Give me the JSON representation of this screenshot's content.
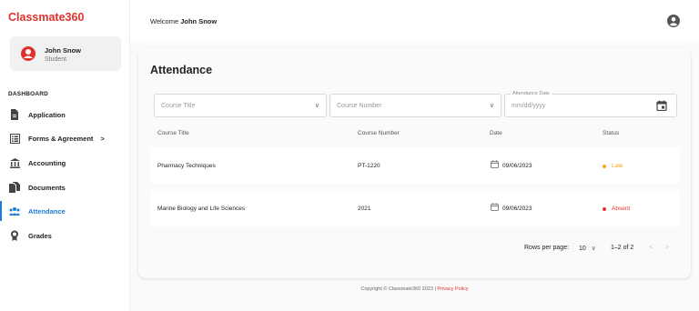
{
  "brand": "Classmate360",
  "user": {
    "name": "John Snow",
    "role": "Student"
  },
  "sidebar": {
    "section": "DASHBOARD",
    "items": [
      {
        "label": "Application",
        "icon": "document-icon"
      },
      {
        "label": "Forms & Agreement",
        "icon": "form-icon",
        "chevron": ">"
      },
      {
        "label": "Accounting",
        "icon": "bank-icon"
      },
      {
        "label": "Documents",
        "icon": "documents-icon"
      },
      {
        "label": "Attendance",
        "icon": "people-icon",
        "active": true
      },
      {
        "label": "Grades",
        "icon": "award-icon"
      }
    ]
  },
  "header": {
    "welcome_prefix": "Welcome",
    "welcome_name": "John Snow"
  },
  "page": {
    "title": "Attendance"
  },
  "filters": {
    "course_title_placeholder": "Course Title",
    "course_number_placeholder": "Course Number",
    "date_label": "Attendance Date",
    "date_placeholder": "mm/dd/yyyy"
  },
  "table": {
    "headers": [
      "Course Title",
      "Course Number",
      "Date",
      "Status"
    ],
    "rows": [
      {
        "course_title": "Pharmacy Techniques",
        "course_number": "PT-1220",
        "date": "09/06/2023",
        "status": "Late",
        "status_color": "#f5a623"
      },
      {
        "course_title": "Marine Biology and Life Sciences",
        "course_number": "2021",
        "date": "09/06/2023",
        "status": "Absent",
        "status_color": "#e0322c"
      }
    ]
  },
  "pagination": {
    "rows_per_page_label": "Rows per page:",
    "rows_per_page_value": "10",
    "range": "1–2 of 2",
    "prev": "<",
    "next": ">"
  },
  "footer": {
    "copyright": "Copyright © Classmate360 2023 | ",
    "privacy_link": "Privacy Policy"
  },
  "colors": {
    "brand": "#e0322c",
    "accent": "#1f7ad6",
    "late": "#f5a623",
    "absent": "#e0322c"
  }
}
